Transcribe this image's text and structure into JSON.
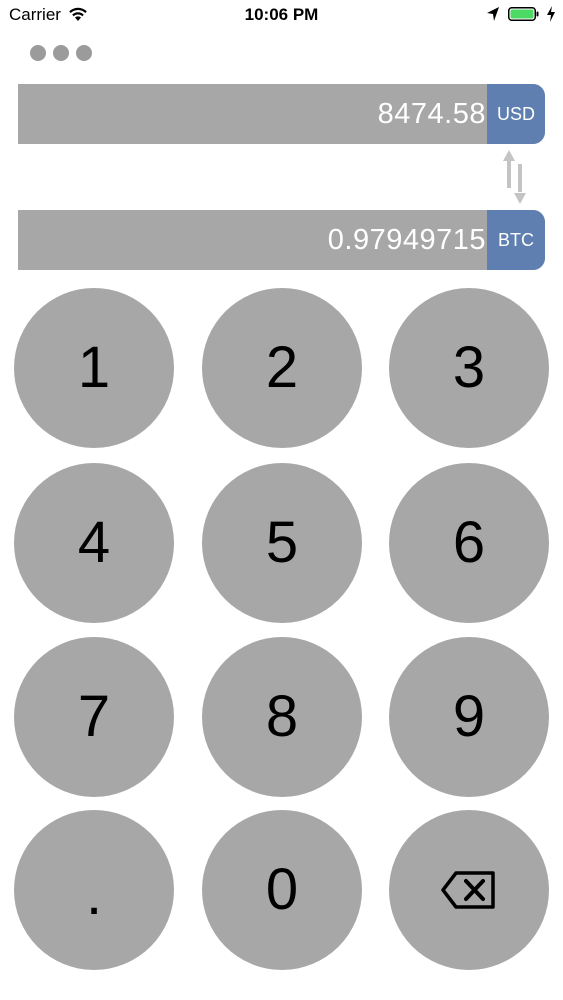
{
  "status_bar": {
    "carrier": "Carrier",
    "time": "10:06 PM",
    "icons": [
      "wifi-icon",
      "location-arrow-icon",
      "battery-icon",
      "charging-bolt-icon"
    ],
    "battery_color": "#4cd964"
  },
  "menu": {
    "icon": "more-dots-icon"
  },
  "converter": {
    "from": {
      "value": "8474.58",
      "currency": "USD"
    },
    "to": {
      "value": "0.97949715",
      "currency": "BTC"
    },
    "swap_icon": "swap-arrows-icon",
    "accent_color": "#5e7fb0",
    "field_color": "#a8a7a8"
  },
  "keypad": {
    "keys": [
      "1",
      "2",
      "3",
      "4",
      "5",
      "6",
      "7",
      "8",
      "9",
      ".",
      "0"
    ],
    "backspace_icon": "backspace-icon"
  }
}
